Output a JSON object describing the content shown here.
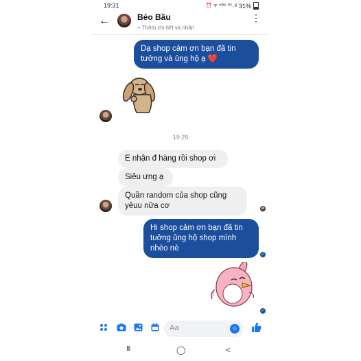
{
  "status_bar": {
    "time": "19:31",
    "icons": "⏰ ᯤ ᵛᵒˡᵗᵉ ⁴ᴳ .ıl",
    "battery": "31%"
  },
  "header": {
    "back": "←",
    "name": "Béo Bầu",
    "subtitle": "+ Thêm chi tiết và nhãn",
    "menu": "⋮"
  },
  "messages": {
    "out_1": "Dạ shop cảm ơn bạn đã tin tưởng và ủng hộ ạ ❤️",
    "timestamp": "19:29",
    "in_1": "E nhận đ hàng rồi shop ơi",
    "in_2": "Siêu ưng ạ",
    "in_3": "Quần random của shop cũng yêuu nữa cơ",
    "out_2": "Hi shop cảm ơn bạn đã tin tuởng ủng hộ shop mình nhèo nè",
    "check": "✓"
  },
  "composer": {
    "placeholder": "Aa",
    "icons": [
      "grid-icon",
      "camera-icon",
      "image-icon",
      "calendar-icon",
      "emoji-icon",
      "like-icon"
    ]
  },
  "colors": {
    "outgoing_bubble": "#1c4e9e",
    "incoming_bubble": "#efefef",
    "accent": "#1877f2"
  },
  "navbar": {
    "recents": "III",
    "home": "◯",
    "back": "<"
  }
}
